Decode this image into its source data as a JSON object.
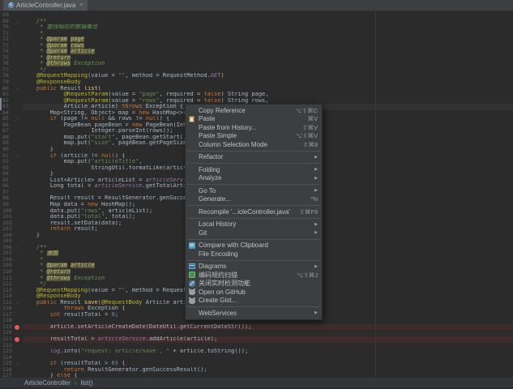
{
  "window": {
    "tab_title": "ArticleController.java",
    "close_icon": "×",
    "class_icon_letter": "C"
  },
  "colors": {
    "editor_bg": "#2b2b2b",
    "menu_bg": "#3c3f41",
    "tab_bg": "#4e5254",
    "keyword": "#cc7832",
    "string": "#6a8759",
    "annotation": "#bbb529",
    "comment_doc": "#629755",
    "line_number": "#606366",
    "breakpoint_dot": "#db5c5c",
    "breakpoint_row_bg": "#3f2b2b",
    "caret_row_bg": "#323232"
  },
  "breadcrumb": {
    "items": [
      "ArticleController",
      "list()"
    ],
    "separator": "›"
  },
  "menu": {
    "items": [
      {
        "label": "Copy Reference",
        "shortcut": "⌥⇧⌘C"
      },
      {
        "label": "Paste",
        "shortcut": "⌘V",
        "icon": "paste"
      },
      {
        "label": "Paste from History...",
        "shortcut": "⇧⌘V"
      },
      {
        "label": "Paste Simple",
        "shortcut": "⌥⇧⌘V"
      },
      {
        "label": "Column Selection Mode",
        "shortcut": "⇧⌘8"
      },
      {
        "sep": true
      },
      {
        "label": "Refactor",
        "submenu": true
      },
      {
        "sep": true
      },
      {
        "label": "Folding",
        "submenu": true
      },
      {
        "label": "Analyze",
        "submenu": true
      },
      {
        "sep": true
      },
      {
        "label": "Go To",
        "submenu": true
      },
      {
        "label": "Generate...",
        "shortcut": "^N"
      },
      {
        "sep": true
      },
      {
        "label": "Recompile '...icleController.java'",
        "shortcut": "⇧⌘F9"
      },
      {
        "sep": true
      },
      {
        "label": "Local History",
        "submenu": true
      },
      {
        "label": "Git",
        "submenu": true
      },
      {
        "sep": true
      },
      {
        "label": "Compare with Clipboard",
        "icon": "diff"
      },
      {
        "label": "File Encoding"
      },
      {
        "sep": true
      },
      {
        "label": "Diagrams",
        "submenu": true,
        "icon": "diagram"
      },
      {
        "label": "编码规约扫描",
        "shortcut": "⌥⇧⌘J",
        "icon": "scan"
      },
      {
        "label": "关闭实时检测功能",
        "icon": "disable"
      },
      {
        "label": "Open on GitHub",
        "icon": "github"
      },
      {
        "label": "Create Gist...",
        "icon": "github"
      },
      {
        "sep": true
      },
      {
        "label": "WebServices",
        "submenu": true
      }
    ]
  },
  "editor": {
    "lines": [
      {
        "n": 68,
        "t": []
      },
      {
        "n": 69,
        "fold": "⌄",
        "t": [
          [
            "d",
            "    /**"
          ]
        ]
      },
      {
        "n": 70,
        "t": [
          [
            "d",
            "     * 查找相应的数据集合"
          ]
        ]
      },
      {
        "n": 71,
        "t": [
          [
            "d",
            "     *"
          ]
        ]
      },
      {
        "n": 72,
        "t": [
          [
            "d",
            "     * "
          ],
          [
            "g",
            "@param"
          ],
          [
            "d",
            " "
          ],
          [
            "g",
            "page"
          ]
        ]
      },
      {
        "n": 73,
        "t": [
          [
            "d",
            "     * "
          ],
          [
            "g",
            "@param"
          ],
          [
            "d",
            " "
          ],
          [
            "g",
            "rows"
          ]
        ]
      },
      {
        "n": 74,
        "t": [
          [
            "d",
            "     * "
          ],
          [
            "g",
            "@param"
          ],
          [
            "d",
            " "
          ],
          [
            "g",
            "article"
          ]
        ]
      },
      {
        "n": 75,
        "t": [
          [
            "d",
            "     * "
          ],
          [
            "g",
            "@return"
          ]
        ]
      },
      {
        "n": 76,
        "t": [
          [
            "d",
            "     * "
          ],
          [
            "g",
            "@throws"
          ],
          [
            "d",
            " Exception"
          ]
        ]
      },
      {
        "n": 77,
        "t": [
          [
            "d",
            "     */"
          ]
        ]
      },
      {
        "n": 78,
        "t": [
          [
            "p",
            "    "
          ],
          [
            "a",
            "@RequestMapping"
          ],
          [
            "p",
            "(value = "
          ],
          [
            "s",
            "\"\""
          ],
          [
            "p",
            ", method = RequestMethod."
          ],
          [
            "c",
            "GET"
          ],
          [
            "p",
            ")"
          ]
        ]
      },
      {
        "n": 79,
        "t": [
          [
            "p",
            "    "
          ],
          [
            "a",
            "@ResponseBody"
          ]
        ]
      },
      {
        "n": 80,
        "fold": "⌄",
        "t": [
          [
            "p",
            "    "
          ],
          [
            "k",
            "public"
          ],
          [
            "p",
            " Result "
          ],
          [
            "y",
            "list"
          ],
          [
            "p",
            "("
          ]
        ]
      },
      {
        "n": 81,
        "t": [
          [
            "p",
            "            "
          ],
          [
            "a",
            "@RequestParam"
          ],
          [
            "p",
            "(value = "
          ],
          [
            "s",
            "\"page\""
          ],
          [
            "p",
            ", required = "
          ],
          [
            "k",
            "false"
          ],
          [
            "p",
            ") String page,"
          ]
        ]
      },
      {
        "n": 82,
        "t": [
          [
            "p",
            "            "
          ],
          [
            "a",
            "@RequestParam"
          ],
          [
            "p",
            "(value = "
          ],
          [
            "s",
            "\"rows\""
          ],
          [
            "p",
            ", required = "
          ],
          [
            "k",
            "false"
          ],
          [
            "p",
            ") String rows,"
          ]
        ]
      },
      {
        "n": 83,
        "m": "caret",
        "t": [
          [
            "p",
            "            Article article) "
          ],
          [
            "k",
            "throws"
          ],
          [
            "p",
            " Exception {"
          ]
        ]
      },
      {
        "n": 84,
        "t": [
          [
            "p",
            "        Map<String, Object> map = "
          ],
          [
            "k",
            "new"
          ],
          [
            "p",
            " HashMap<>();"
          ]
        ]
      },
      {
        "n": 85,
        "fold": "⌄",
        "t": [
          [
            "p",
            "        "
          ],
          [
            "k",
            "if"
          ],
          [
            "p",
            " (page != "
          ],
          [
            "k",
            "null"
          ],
          [
            "p",
            " && rows != "
          ],
          [
            "k",
            "null"
          ],
          [
            "p",
            ") {"
          ]
        ]
      },
      {
        "n": 86,
        "t": [
          [
            "p",
            "            PageBean pageBean = "
          ],
          [
            "k",
            "new"
          ],
          [
            "p",
            " PageBean(Integer.p"
          ]
        ]
      },
      {
        "n": 87,
        "t": [
          [
            "p",
            "                    Integer.parseInt(rows));"
          ]
        ]
      },
      {
        "n": 88,
        "t": [
          [
            "p",
            "            map.put("
          ],
          [
            "s",
            "\"start\""
          ],
          [
            "p",
            ", pageBean.getStart());"
          ]
        ]
      },
      {
        "n": 89,
        "t": [
          [
            "p",
            "            map.put("
          ],
          [
            "s",
            "\"size\""
          ],
          [
            "p",
            ", pageBean.getPageSize());"
          ]
        ]
      },
      {
        "n": 90,
        "t": [
          [
            "p",
            "        }"
          ]
        ]
      },
      {
        "n": 91,
        "fold": "⌄",
        "t": [
          [
            "p",
            "        "
          ],
          [
            "k",
            "if"
          ],
          [
            "p",
            " (article != "
          ],
          [
            "k",
            "null"
          ],
          [
            "p",
            ") {"
          ]
        ]
      },
      {
        "n": 92,
        "t": [
          [
            "p",
            "            map.put("
          ],
          [
            "s",
            "\"articleTitle\""
          ],
          [
            "p",
            ","
          ]
        ]
      },
      {
        "n": 93,
        "t": [
          [
            "p",
            "                    StringUtil.formatLike(article.getA"
          ]
        ]
      },
      {
        "n": 94,
        "t": [
          [
            "p",
            "        }"
          ]
        ]
      },
      {
        "n": 95,
        "t": [
          [
            "p",
            "        List<Article> articleList = "
          ],
          [
            "f",
            "articleService"
          ],
          [
            "p",
            ".fin"
          ]
        ]
      },
      {
        "n": 96,
        "t": [
          [
            "p",
            "        Long total = "
          ],
          [
            "f",
            "articleService"
          ],
          [
            "p",
            ".getTotalArticle(ma"
          ]
        ]
      },
      {
        "n": 97,
        "t": []
      },
      {
        "n": 98,
        "t": [
          [
            "p",
            "        Result result = ResultGenerator.genSuccessResu"
          ]
        ]
      },
      {
        "n": 99,
        "t": [
          [
            "p",
            "        Map data = "
          ],
          [
            "k",
            "new"
          ],
          [
            "p",
            " HashMap();"
          ]
        ]
      },
      {
        "n": 100,
        "t": [
          [
            "p",
            "        data.put("
          ],
          [
            "s",
            "\"rows\""
          ],
          [
            "p",
            ", articleList);"
          ]
        ]
      },
      {
        "n": 101,
        "t": [
          [
            "p",
            "        data.put("
          ],
          [
            "s",
            "\"total\""
          ],
          [
            "p",
            ", total);"
          ]
        ]
      },
      {
        "n": 102,
        "t": [
          [
            "p",
            "        result.setData(data);"
          ]
        ]
      },
      {
        "n": 103,
        "t": [
          [
            "p",
            "        "
          ],
          [
            "k",
            "return"
          ],
          [
            "p",
            " result;"
          ]
        ]
      },
      {
        "n": 104,
        "t": [
          [
            "p",
            "    }"
          ]
        ]
      },
      {
        "n": 105,
        "t": []
      },
      {
        "n": 106,
        "fold": "⌄",
        "t": [
          [
            "d",
            "    /**"
          ]
        ]
      },
      {
        "n": 107,
        "t": [
          [
            "d",
            "     * "
          ],
          [
            "g",
            "添加"
          ]
        ]
      },
      {
        "n": 108,
        "t": [
          [
            "d",
            "     *"
          ]
        ]
      },
      {
        "n": 109,
        "t": [
          [
            "d",
            "     * "
          ],
          [
            "g",
            "@param"
          ],
          [
            "d",
            " "
          ],
          [
            "g",
            "article"
          ]
        ]
      },
      {
        "n": 110,
        "t": [
          [
            "d",
            "     * "
          ],
          [
            "g",
            "@return"
          ]
        ]
      },
      {
        "n": 111,
        "t": [
          [
            "d",
            "     * "
          ],
          [
            "g",
            "@throws"
          ],
          [
            "d",
            " Exception"
          ]
        ]
      },
      {
        "n": 112,
        "t": [
          [
            "d",
            "     */"
          ]
        ]
      },
      {
        "n": 113,
        "t": [
          [
            "p",
            "    "
          ],
          [
            "a",
            "@RequestMapping"
          ],
          [
            "p",
            "(value = "
          ],
          [
            "s",
            "\"\""
          ],
          [
            "p",
            ", method = RequestMethod"
          ]
        ]
      },
      {
        "n": 114,
        "t": [
          [
            "p",
            "    "
          ],
          [
            "a",
            "@ResponseBody"
          ]
        ]
      },
      {
        "n": 115,
        "fold": "⌄",
        "t": [
          [
            "p",
            "    "
          ],
          [
            "k",
            "public"
          ],
          [
            "p",
            " Result "
          ],
          [
            "y",
            "save"
          ],
          [
            "p",
            "("
          ],
          [
            "a",
            "@RequestBody"
          ],
          [
            "p",
            " Article article)"
          ]
        ]
      },
      {
        "n": 116,
        "t": [
          [
            "p",
            "            "
          ],
          [
            "k",
            "throws"
          ],
          [
            "p",
            " Exception {"
          ]
        ]
      },
      {
        "n": 117,
        "t": [
          [
            "p",
            "        "
          ],
          [
            "k",
            "int"
          ],
          [
            "p",
            " resultTotal = "
          ],
          [
            "n",
            "0"
          ],
          [
            "p",
            ";"
          ]
        ]
      },
      {
        "n": 118,
        "t": []
      },
      {
        "n": 119,
        "m": "bp",
        "t": [
          [
            "p",
            "        article.setArticleCreateDate(DateUtil.getCurrentDateStr());"
          ]
        ]
      },
      {
        "n": 120,
        "t": []
      },
      {
        "n": 121,
        "m": "bp",
        "t": [
          [
            "p",
            "        resultTotal = "
          ],
          [
            "f",
            "articleService"
          ],
          [
            "p",
            ".addArticle(article);"
          ]
        ]
      },
      {
        "n": 122,
        "t": []
      },
      {
        "n": 123,
        "t": [
          [
            "p",
            "        "
          ],
          [
            "f",
            "log"
          ],
          [
            "p",
            ".info("
          ],
          [
            "s",
            "\"request: article/save , \""
          ],
          [
            "p",
            " + article.toString());"
          ]
        ]
      },
      {
        "n": 124,
        "t": []
      },
      {
        "n": 125,
        "fold": "⌄",
        "t": [
          [
            "p",
            "        "
          ],
          [
            "k",
            "if"
          ],
          [
            "p",
            " (resultTotal > "
          ],
          [
            "n",
            "0"
          ],
          [
            "p",
            ") {"
          ]
        ]
      },
      {
        "n": 126,
        "t": [
          [
            "p",
            "            "
          ],
          [
            "k",
            "return"
          ],
          [
            "p",
            " ResultGenerator.genSuccessResult();"
          ]
        ]
      },
      {
        "n": 127,
        "t": [
          [
            "p",
            "        } "
          ],
          [
            "k",
            "else"
          ],
          [
            "p",
            " {"
          ]
        ]
      }
    ]
  }
}
